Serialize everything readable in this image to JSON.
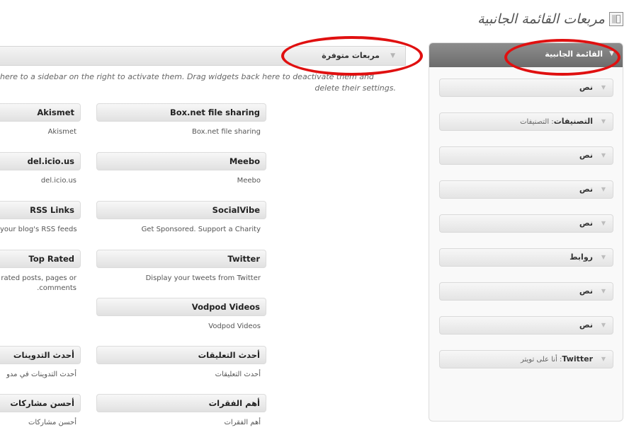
{
  "page": {
    "title": "مربعات القائمة الجانبية"
  },
  "available": {
    "title": "مربعات متوفرة",
    "description_line1": "here to a sidebar on the right to activate them. Drag widgets back here to deactivate them and",
    "description_line2": ".delete their settings"
  },
  "widgets_left": [
    {
      "title": "Akismet",
      "desc": "Akismet"
    },
    {
      "title": "del.icio.us",
      "desc": "del.icio.us"
    },
    {
      "title": "RSS Links",
      "desc": "your blog's RSS feeds"
    },
    {
      "title": "Top Rated",
      "desc": "rated posts, pages or",
      "desc2": ".comments"
    },
    {
      "title": "أحدث التدوينات",
      "desc": "أحدث التدوينات في مدو"
    },
    {
      "title": "أحسن مشاركات",
      "desc": "أحسن مشاركات"
    }
  ],
  "widgets_right": [
    {
      "title": "Box.net file sharing",
      "desc": "Box.net file sharing"
    },
    {
      "title": "Meebo",
      "desc": "Meebo"
    },
    {
      "title": "SocialVibe",
      "desc": "Get Sponsored. Support a Charity"
    },
    {
      "title": "Twitter",
      "desc": "Display your tweets from Twitter"
    },
    {
      "title": "Vodpod Videos",
      "desc": "Vodpod Videos"
    },
    {
      "title": "أحدث التعليقات",
      "desc": "أحدث التعليقات"
    },
    {
      "title": "أهم الفقرات",
      "desc": "أهم الفقرات"
    }
  ],
  "sidebar": {
    "title": "القائمة الجانبية",
    "items": [
      {
        "title": "نص",
        "sub": ""
      },
      {
        "title": "التصنيفات",
        "sub": ": التصنيفات"
      },
      {
        "title": "نص",
        "sub": ""
      },
      {
        "title": "نص",
        "sub": ""
      },
      {
        "title": "نص",
        "sub": ""
      },
      {
        "title": "روابط",
        "sub": ""
      },
      {
        "title": "نص",
        "sub": ""
      },
      {
        "title": "نص",
        "sub": ""
      },
      {
        "title": "Twitter",
        "sub": ": أنا على تويتر"
      }
    ]
  },
  "icons": {
    "header": "widgets-screen-icon",
    "toggle": "triangle-down-icon"
  },
  "colors": {
    "annotation": "#e01010",
    "sidebar_header": "#7a7a7a"
  }
}
